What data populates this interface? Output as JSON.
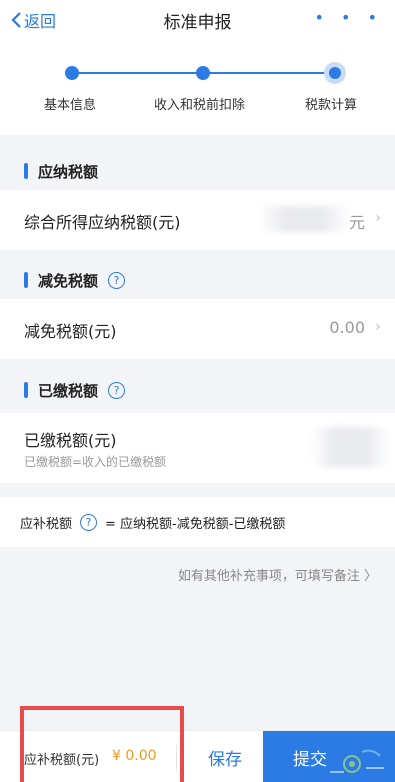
{
  "header": {
    "back_label": "返回",
    "title": "标准申报",
    "more_label": "• • •"
  },
  "steps": [
    {
      "label": "基本信息"
    },
    {
      "label": "收入和税前扣除"
    },
    {
      "label": "税款计算"
    }
  ],
  "current_step": 3,
  "sections": {
    "payable": {
      "title": "应纳税额",
      "row_label": "综合所得应纳税额(元)",
      "row_value_suffix": "元"
    },
    "reduction": {
      "title": "减免税额",
      "help_icon": "question-circle-icon",
      "row_label": "减免税额(元)",
      "row_value": "0.00"
    },
    "paid": {
      "title": "已缴税额",
      "help_icon": "question-circle-icon",
      "row_label": "已缴税额(元)",
      "row_sub": "已缴税额=收入的已缴税额"
    }
  },
  "formula": {
    "label": "应补税额",
    "text": "= 应纳税额-减免税额-已缴税额"
  },
  "remark_link": "如有其他补充事项，可填写备注",
  "bottom_bar": {
    "label": "应补税额(元)",
    "amount": "¥ 0.00",
    "save": "保存",
    "submit": "提交"
  },
  "colors": {
    "accent": "#2c7be5",
    "amount": "#f39a1e",
    "highlight": "#e94a4a"
  }
}
